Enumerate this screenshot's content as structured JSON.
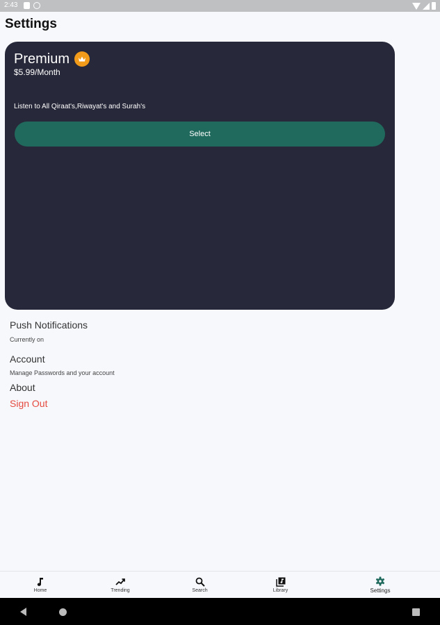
{
  "status_bar": {
    "time": "2:43"
  },
  "page": {
    "title": "Settings"
  },
  "premium": {
    "name": "Premium",
    "price": "$5.99/Month",
    "description": "Listen to All Qiraat's,Riwayat's and Surah's",
    "select_label": "Select",
    "card_color": "#272839",
    "button_color": "#206a5d",
    "badge_color": "#f29b1a"
  },
  "settings": {
    "push": {
      "title": "Push Notifications",
      "subtitle": "Currently on"
    },
    "account": {
      "title": "Account",
      "subtitle": "Manage Passwords and your account"
    },
    "about": {
      "title": "About"
    },
    "sign_out": {
      "label": "Sign Out",
      "color": "#e54a3f"
    }
  },
  "bottom_nav": {
    "items": [
      {
        "label": "Home",
        "icon": "music-note-icon"
      },
      {
        "label": "Trending",
        "icon": "trending-icon"
      },
      {
        "label": "Search",
        "icon": "search-icon"
      },
      {
        "label": "Library",
        "icon": "library-icon"
      },
      {
        "label": "Settings",
        "icon": "gear-icon",
        "active": true
      }
    ],
    "active_color": "#206a5d"
  }
}
